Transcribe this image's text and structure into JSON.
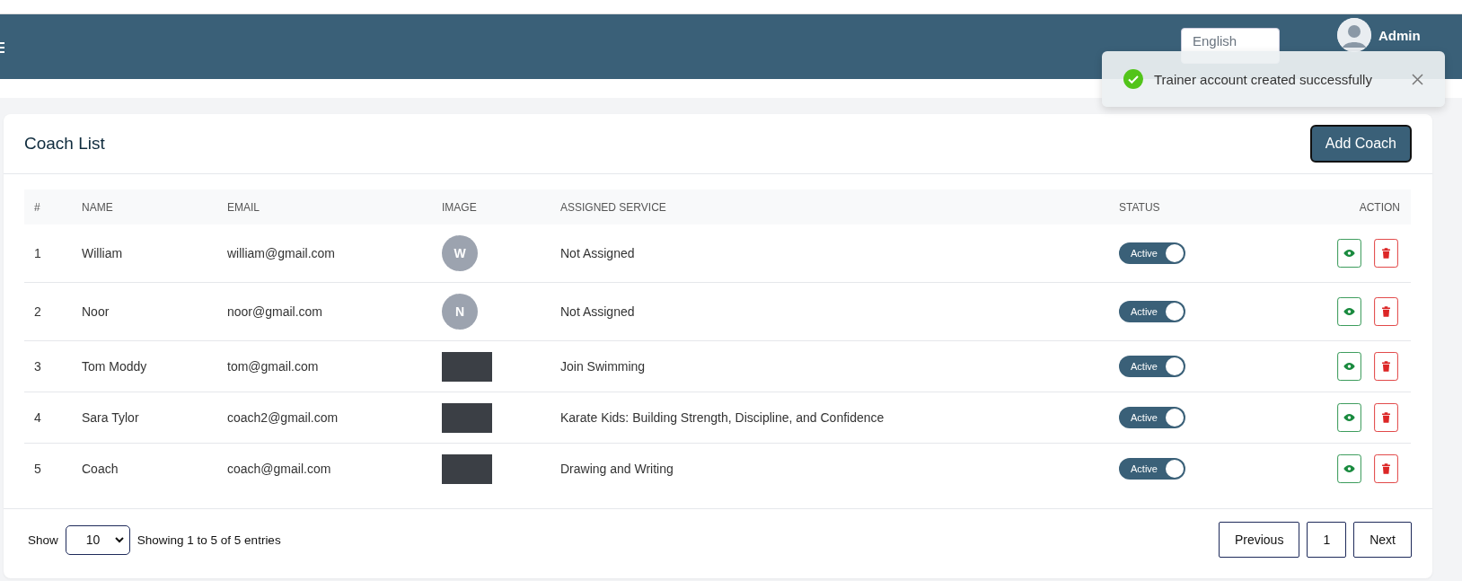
{
  "header": {
    "language": "English",
    "user": "Admin"
  },
  "toast": {
    "message": "Trainer account created successfully"
  },
  "card": {
    "title": "Coach List",
    "add_button": "Add Coach"
  },
  "table": {
    "columns": [
      "#",
      "NAME",
      "EMAIL",
      "IMAGE",
      "ASSIGNED SERVICE",
      "STATUS",
      "ACTION"
    ],
    "rows": [
      {
        "index": "1",
        "name": "William",
        "email": "william@gmail.com",
        "image": {
          "kind": "initial",
          "text": "W"
        },
        "service": "Not Assigned",
        "status": "Active",
        "active": true
      },
      {
        "index": "2",
        "name": "Noor",
        "email": "noor@gmail.com",
        "image": {
          "kind": "initial",
          "text": "N"
        },
        "service": "Not Assigned",
        "status": "Active",
        "active": true
      },
      {
        "index": "3",
        "name": "Tom Moddy",
        "email": "tom@gmail.com",
        "image": {
          "kind": "photo"
        },
        "service": "Join Swimming",
        "status": "Active",
        "active": true
      },
      {
        "index": "4",
        "name": "Sara Tylor",
        "email": "coach2@gmail.com",
        "image": {
          "kind": "photo"
        },
        "service": "Karate Kids: Building Strength, Discipline, and Confidence",
        "status": "Active",
        "active": true
      },
      {
        "index": "5",
        "name": "Coach",
        "email": "coach@gmail.com",
        "image": {
          "kind": "photo"
        },
        "service": "Drawing and Writing",
        "status": "Active",
        "active": true
      }
    ]
  },
  "footer": {
    "show_label": "Show",
    "page_size": "10",
    "info": "Showing 1 to 5 of 5 entries",
    "pagination": [
      "Previous",
      "1",
      "Next"
    ]
  }
}
